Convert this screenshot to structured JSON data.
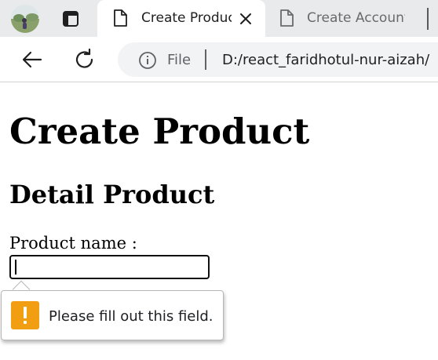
{
  "browser": {
    "tabs": [
      {
        "title": "Create Product",
        "active": true
      },
      {
        "title": "Create Account",
        "active": false
      }
    ],
    "address_bar": {
      "security_label": "File",
      "url": "D:/react_faridhotul-nur-aizah/"
    }
  },
  "page": {
    "heading": "Create Product",
    "subheading": "Detail Product",
    "product_name_label": "Product name :",
    "product_name_value": ""
  },
  "validation": {
    "message": "Please fill out this field."
  },
  "colors": {
    "tab_strip_bg": "#e9eaeb",
    "omnibox_bg": "#f1f3f4",
    "warning": "#f29e12"
  }
}
